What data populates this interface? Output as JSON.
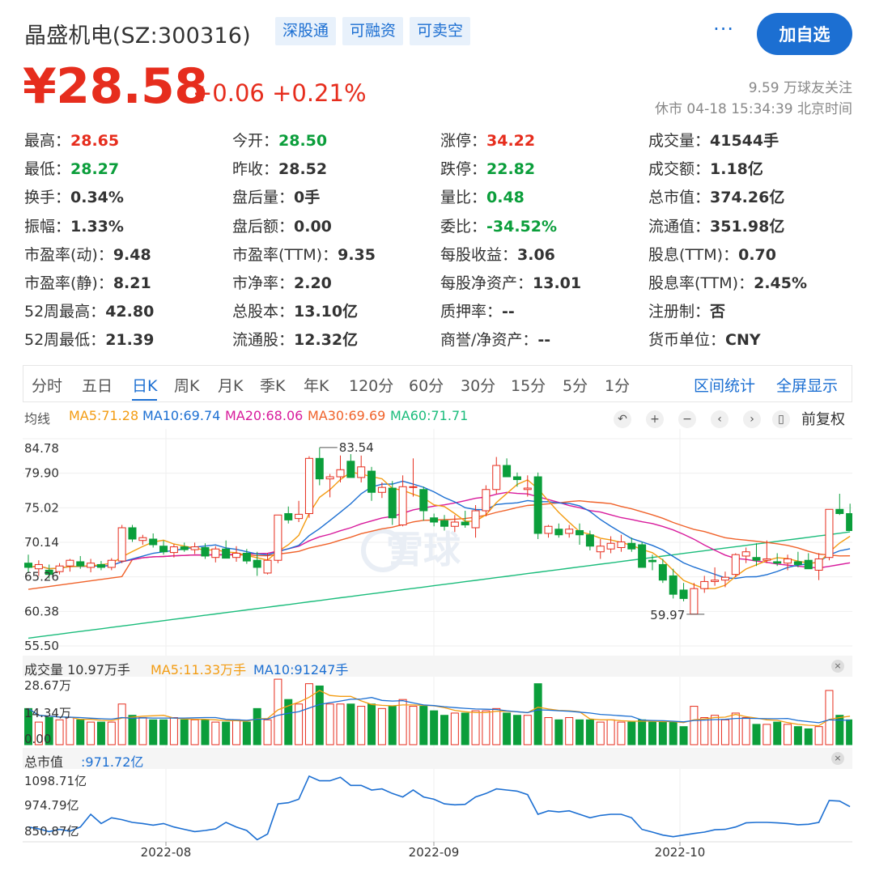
{
  "header": {
    "stock_title": "晶盛机电(SZ:300316)",
    "tags": [
      "深股通",
      "可融资",
      "可卖空"
    ],
    "more": "···",
    "add_watch": "加自选"
  },
  "quote": {
    "price": "¥28.58",
    "change": "+0.06 +0.21%",
    "followers": "9.59 万球友关注",
    "market_time": "休市 04-18 15:34:39 北京时间"
  },
  "stats": [
    [
      {
        "k": "最高：",
        "v": "28.65",
        "c": "up"
      },
      {
        "k": "今开：",
        "v": "28.50",
        "c": "down"
      },
      {
        "k": "涨停：",
        "v": "34.22",
        "c": "up"
      },
      {
        "k": "成交量：",
        "v": "41544手",
        "c": ""
      }
    ],
    [
      {
        "k": "最低：",
        "v": "28.27",
        "c": "down"
      },
      {
        "k": "昨收：",
        "v": "28.52",
        "c": ""
      },
      {
        "k": "跌停：",
        "v": "22.82",
        "c": "down"
      },
      {
        "k": "成交额：",
        "v": "1.18亿",
        "c": ""
      }
    ],
    [
      {
        "k": "换手：",
        "v": "0.34%",
        "c": ""
      },
      {
        "k": "盘后量：",
        "v": "0手",
        "c": ""
      },
      {
        "k": "量比：",
        "v": "0.48",
        "c": "down"
      },
      {
        "k": "总市值：",
        "v": "374.26亿",
        "c": ""
      }
    ],
    [
      {
        "k": "振幅：",
        "v": "1.33%",
        "c": ""
      },
      {
        "k": "盘后额：",
        "v": "0.00",
        "c": ""
      },
      {
        "k": "委比：",
        "v": "-34.52%",
        "c": "down"
      },
      {
        "k": "流通值：",
        "v": "351.98亿",
        "c": ""
      }
    ],
    [
      {
        "k": "市盈率(动)：",
        "v": "9.48",
        "c": ""
      },
      {
        "k": "市盈率(TTM)：",
        "v": "9.35",
        "c": ""
      },
      {
        "k": "每股收益：",
        "v": "3.06",
        "c": ""
      },
      {
        "k": "股息(TTM)：",
        "v": "0.70",
        "c": ""
      }
    ],
    [
      {
        "k": "市盈率(静)：",
        "v": "8.21",
        "c": ""
      },
      {
        "k": "市净率：",
        "v": "2.20",
        "c": ""
      },
      {
        "k": "每股净资产：",
        "v": "13.01",
        "c": ""
      },
      {
        "k": "股息率(TTM)：",
        "v": "2.45%",
        "c": ""
      }
    ],
    [
      {
        "k": "52周最高：",
        "v": "42.80",
        "c": ""
      },
      {
        "k": "总股本：",
        "v": "13.10亿",
        "c": ""
      },
      {
        "k": "质押率：",
        "v": "--",
        "c": ""
      },
      {
        "k": "注册制：",
        "v": "否",
        "c": ""
      }
    ],
    [
      {
        "k": "52周最低：",
        "v": "21.39",
        "c": ""
      },
      {
        "k": "流通股：",
        "v": "12.32亿",
        "c": ""
      },
      {
        "k": "商誉/净资产：",
        "v": "--",
        "c": ""
      },
      {
        "k": "货币单位：",
        "v": "CNY",
        "c": ""
      }
    ]
  ],
  "periods": [
    "分时",
    "五日",
    "日K",
    "周K",
    "月K",
    "季K",
    "年K",
    "120分",
    "60分",
    "30分",
    "15分",
    "5分",
    "1分"
  ],
  "active_period": "日K",
  "period_links": [
    "区间统计",
    "全屏显示"
  ],
  "ma": {
    "label": "均线",
    "items": [
      {
        "text": "MA5:71.28",
        "color": "#f39c12"
      },
      {
        "text": "MA10:69.74",
        "color": "#1c6fd2"
      },
      {
        "text": "MA20:68.06",
        "color": "#d81b9c"
      },
      {
        "text": "MA30:69.69",
        "color": "#f0622a"
      },
      {
        "text": "MA60:71.71",
        "color": "#1abc7b"
      }
    ],
    "controls": [
      "↶",
      "+",
      "−",
      "‹",
      "›",
      "▯"
    ],
    "adjust": "前复权"
  },
  "volume_header": {
    "label": "成交量 10.97万手",
    "ma5": "MA5:11.33万手",
    "ma10": "MA10:91247手",
    "close": "×"
  },
  "cap_header": {
    "label": "总市值",
    "value": ":971.72亿",
    "close": "×"
  },
  "watermark": "雪球",
  "colors": {
    "up": "#e62d1d",
    "down": "#0b9e3b",
    "accent": "#1c6fd2"
  },
  "chart_data": {
    "type": "candlestick",
    "y_ticks": [
      "84.78",
      "79.90",
      "75.02",
      "70.14",
      "65.26",
      "60.38",
      "55.50"
    ],
    "ylim": [
      55.5,
      84.78
    ],
    "annotations": [
      {
        "text": "83.54"
      },
      {
        "text": "59.97"
      }
    ],
    "x_labels": [
      "2022-08",
      "2022-09",
      "2022-10"
    ],
    "volume_ticks": [
      "28.67万",
      "14.34万",
      "0.00"
    ],
    "cap_ticks": [
      "1098.71亿",
      "974.79亿",
      "850.87亿"
    ],
    "candles": [
      [
        67.2,
        68.4,
        65.8,
        66.6
      ],
      [
        66.4,
        67.6,
        65.4,
        67.0
      ],
      [
        66.2,
        67.0,
        65.0,
        65.6
      ],
      [
        66.0,
        67.2,
        65.6,
        66.8
      ],
      [
        66.8,
        67.8,
        66.0,
        67.6
      ],
      [
        67.4,
        68.2,
        66.4,
        66.8
      ],
      [
        66.6,
        67.8,
        65.9,
        67.2
      ],
      [
        67.0,
        67.5,
        66.2,
        66.6
      ],
      [
        66.6,
        67.9,
        66.2,
        67.6
      ],
      [
        67.5,
        72.6,
        67.2,
        72.2
      ],
      [
        72.2,
        72.6,
        70.2,
        70.6
      ],
      [
        70.4,
        71.2,
        69.8,
        70.8
      ],
      [
        70.6,
        71.4,
        69.4,
        69.8
      ],
      [
        69.6,
        70.4,
        68.4,
        68.8
      ],
      [
        68.7,
        69.9,
        68.0,
        69.5
      ],
      [
        69.5,
        70.1,
        68.8,
        69.1
      ],
      [
        69.1,
        70.1,
        68.5,
        69.5
      ],
      [
        69.4,
        70.0,
        67.8,
        68.2
      ],
      [
        68.0,
        69.6,
        67.3,
        69.2
      ],
      [
        69.2,
        70.4,
        67.9,
        67.9
      ],
      [
        68.0,
        69.6,
        67.4,
        68.6
      ],
      [
        68.6,
        69.2,
        67.1,
        67.5
      ],
      [
        67.6,
        68.8,
        65.4,
        66.6
      ],
      [
        65.8,
        68.6,
        65.6,
        67.6
      ],
      [
        67.6,
        74.0,
        67.2,
        74.0
      ],
      [
        74.2,
        75.2,
        72.8,
        73.3
      ],
      [
        73.5,
        76.0,
        73.0,
        74.1
      ],
      [
        74.2,
        82.3,
        73.6,
        82.0
      ],
      [
        82.0,
        83.5,
        78.2,
        79.1
      ],
      [
        79.1,
        79.8,
        76.5,
        79.4
      ],
      [
        79.4,
        82.4,
        78.6,
        80.4
      ],
      [
        81.6,
        82.6,
        79.3,
        79.3
      ],
      [
        79.3,
        82.4,
        78.6,
        80.8
      ],
      [
        80.2,
        80.8,
        76.0,
        77.2
      ],
      [
        77.2,
        78.6,
        76.4,
        77.9
      ],
      [
        77.8,
        78.8,
        72.6,
        73.6
      ],
      [
        72.6,
        79.6,
        72.4,
        78.0
      ],
      [
        78.0,
        82.0,
        76.6,
        78.0
      ],
      [
        77.6,
        78.0,
        73.2,
        74.6
      ],
      [
        73.6,
        74.2,
        72.4,
        73.0
      ],
      [
        73.2,
        74.0,
        71.8,
        72.4
      ],
      [
        72.4,
        74.0,
        71.6,
        73.0
      ],
      [
        73.0,
        74.6,
        72.2,
        72.6
      ],
      [
        72.2,
        75.4,
        70.8,
        74.6
      ],
      [
        74.6,
        78.2,
        73.8,
        77.6
      ],
      [
        77.6,
        82.2,
        77.0,
        81.0
      ],
      [
        81.0,
        82.0,
        79.8,
        79.4
      ],
      [
        79.4,
        80.0,
        78.0,
        79.0
      ],
      [
        77.6,
        79.6,
        76.6,
        77.8
      ],
      [
        79.4,
        80.0,
        70.6,
        71.4
      ],
      [
        71.4,
        72.6,
        70.8,
        72.4
      ],
      [
        72.0,
        72.8,
        70.8,
        71.2
      ],
      [
        71.4,
        72.6,
        70.8,
        72.0
      ],
      [
        71.8,
        72.8,
        69.8,
        71.2
      ],
      [
        71.2,
        71.8,
        69.0,
        69.6
      ],
      [
        68.8,
        70.6,
        67.8,
        69.6
      ],
      [
        69.2,
        71.0,
        68.6,
        70.0
      ],
      [
        69.4,
        71.2,
        68.8,
        70.2
      ],
      [
        70.0,
        70.8,
        68.8,
        69.2
      ],
      [
        69.8,
        70.2,
        66.6,
        66.6
      ],
      [
        67.6,
        68.4,
        66.2,
        67.4
      ],
      [
        67.0,
        67.8,
        64.4,
        64.8
      ],
      [
        65.4,
        66.4,
        62.2,
        62.8
      ],
      [
        63.4,
        64.4,
        61.8,
        62.2
      ],
      [
        60.0,
        64.4,
        59.97,
        63.6
      ],
      [
        63.6,
        65.4,
        63.0,
        64.6
      ],
      [
        64.6,
        66.6,
        64.0,
        64.8
      ],
      [
        64.8,
        66.0,
        63.8,
        65.2
      ],
      [
        65.6,
        68.6,
        65.2,
        68.4
      ],
      [
        68.2,
        69.4,
        67.2,
        68.8
      ],
      [
        68.0,
        70.0,
        66.8,
        67.6
      ],
      [
        67.6,
        70.4,
        67.2,
        67.8
      ],
      [
        67.4,
        68.6,
        66.8,
        67.2
      ],
      [
        67.2,
        68.4,
        66.2,
        67.8
      ],
      [
        67.4,
        68.8,
        66.6,
        67.0
      ],
      [
        67.6,
        68.6,
        66.8,
        66.4
      ],
      [
        66.2,
        68.6,
        64.8,
        67.8
      ],
      [
        68.0,
        74.8,
        67.6,
        74.8
      ],
      [
        74.8,
        77.0,
        74.0,
        74.2
      ],
      [
        74.2,
        75.6,
        71.8,
        71.8
      ]
    ],
    "volumes": [
      0.16,
      0.1,
      0.12,
      0.11,
      0.12,
      0.11,
      0.1,
      0.1,
      0.1,
      0.18,
      0.13,
      0.12,
      0.11,
      0.11,
      0.12,
      0.11,
      0.11,
      0.11,
      0.1,
      0.1,
      0.11,
      0.1,
      0.16,
      0.11,
      0.29,
      0.2,
      0.18,
      0.27,
      0.26,
      0.18,
      0.18,
      0.18,
      0.17,
      0.18,
      0.16,
      0.17,
      0.2,
      0.17,
      0.17,
      0.15,
      0.13,
      0.14,
      0.14,
      0.15,
      0.15,
      0.16,
      0.14,
      0.13,
      0.13,
      0.27,
      0.12,
      0.11,
      0.12,
      0.11,
      0.11,
      0.1,
      0.11,
      0.1,
      0.1,
      0.11,
      0.1,
      0.1,
      0.1,
      0.08,
      0.17,
      0.12,
      0.13,
      0.11,
      0.14,
      0.12,
      0.09,
      0.09,
      0.1,
      0.09,
      0.08,
      0.07,
      0.08,
      0.24,
      0.13,
      0.11
    ],
    "market_cap": [
      880,
      872,
      860,
      870,
      862,
      880,
      935,
      895,
      920,
      912,
      900,
      895,
      888,
      895,
      880,
      870,
      860,
      865,
      872,
      900,
      880,
      865,
      825,
      850,
      980,
      985,
      1000,
      1100,
      1080,
      1080,
      1095,
      1060,
      1060,
      1040,
      1045,
      1025,
      1010,
      1040,
      1010,
      1000,
      980,
      976,
      978,
      1010,
      1025,
      1045,
      1040,
      1035,
      1020,
      935,
      950,
      945,
      950,
      935,
      920,
      930,
      935,
      935,
      920,
      870,
      858,
      845,
      838,
      845,
      852,
      858,
      868,
      870,
      880,
      898,
      900,
      900,
      898,
      895,
      890,
      892,
      900,
      995,
      992,
      968
    ]
  }
}
